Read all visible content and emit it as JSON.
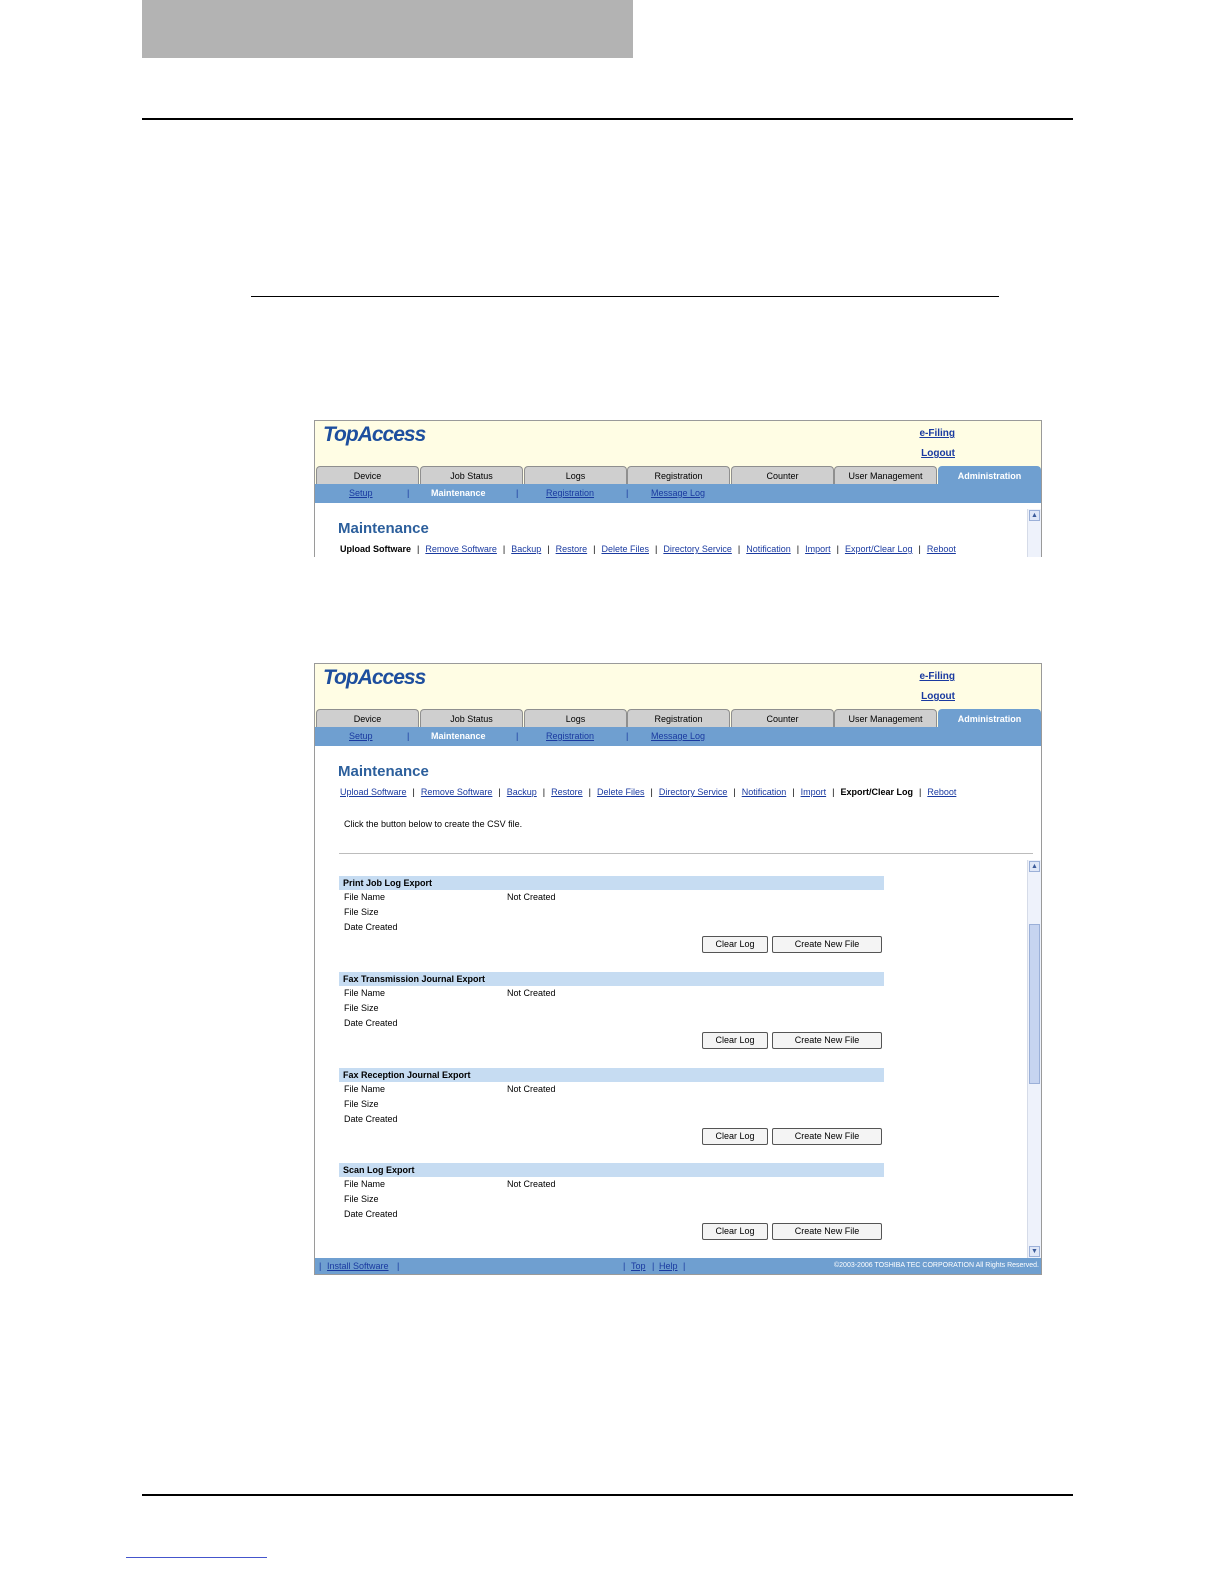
{
  "app": {
    "logo": "TopAccess",
    "efiling_link": "e-Filing",
    "logout_link": "Logout",
    "tabs": [
      "Device",
      "Job Status",
      "Logs",
      "Registration",
      "Counter",
      "User Management",
      "Administration"
    ],
    "active_tab": "Administration",
    "subnav": [
      "Setup",
      "Maintenance",
      "Registration",
      "Message Log"
    ],
    "active_subnav": "Maintenance",
    "page_title": "Maintenance"
  },
  "screenshot1": {
    "menu": [
      "Upload Software",
      "Remove Software",
      "Backup",
      "Restore",
      "Delete Files",
      "Directory Service",
      "Notification",
      "Import",
      "Export/Clear Log",
      "Reboot"
    ],
    "current": "Upload Software"
  },
  "screenshot2": {
    "menu": [
      "Upload Software",
      "Remove Software",
      "Backup",
      "Restore",
      "Delete Files",
      "Directory Service",
      "Notification",
      "Import",
      "Export/Clear Log",
      "Reboot"
    ],
    "current": "Export/Clear Log",
    "instruction": "Click the button below to create the CSV file.",
    "field_labels": [
      "File Name",
      "File Size",
      "Date Created"
    ],
    "clear_button": "Clear Log",
    "create_button": "Create New File",
    "sections": [
      {
        "title": "Print Job Log Export",
        "file_name": "Not Created"
      },
      {
        "title": "Fax Transmission Journal Export",
        "file_name": "Not Created"
      },
      {
        "title": "Fax Reception Journal Export",
        "file_name": "Not Created"
      },
      {
        "title": "Scan Log Export",
        "file_name": "Not Created"
      }
    ],
    "footer": {
      "install_link": "Install Software",
      "top_link": "Top",
      "help_link": "Help",
      "copyright": "©2003-2006 TOSHIBA TEC CORPORATION All Rights Reserved."
    }
  }
}
